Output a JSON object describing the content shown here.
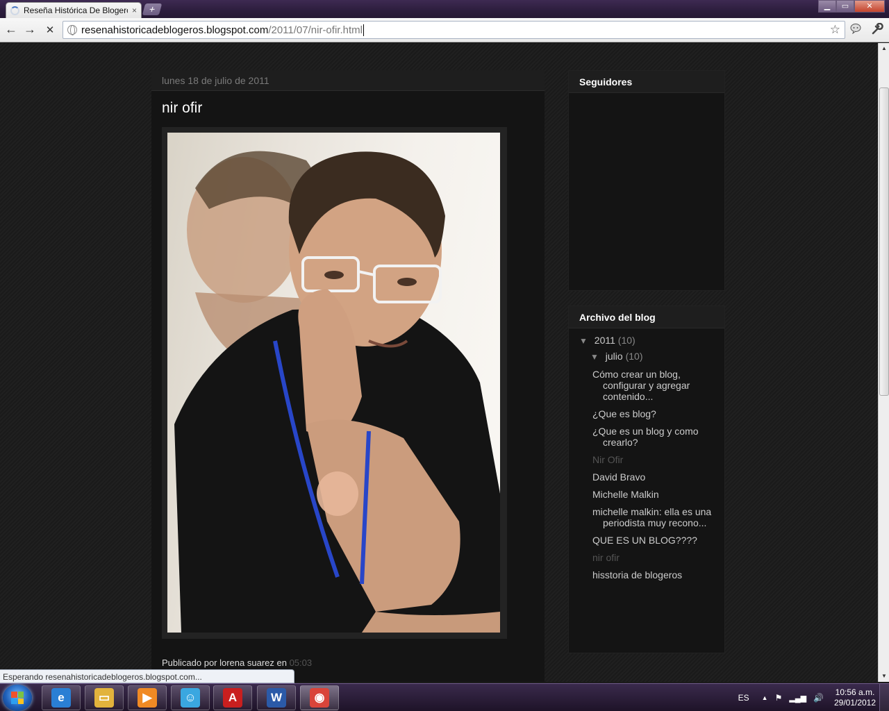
{
  "browser": {
    "tab_title": "Reseña Histórica De Blogeros",
    "tab_close": "×",
    "new_tab": "+",
    "window_buttons": {
      "minimize": "▁",
      "maximize": "▭",
      "close": "✕"
    },
    "nav": {
      "back": "←",
      "forward": "→",
      "stop": "✕"
    },
    "url_host": "resenahistoricadeblogeros.blogspot.com",
    "url_path": "/2011/07/nir-ofir.html",
    "bookmark_star": "☆",
    "icons": {
      "extension": "chat-bubble-icon",
      "wrench": "wrench-icon"
    },
    "status_text": "Esperando resenahistoricadeblogeros.blogspot.com..."
  },
  "post": {
    "date": "lunes 18 de julio de 2011",
    "title": "nir ofir",
    "byline_prefix": "Publicado por lorena suarez en",
    "byline_time": "05:03"
  },
  "sidebar": {
    "followers": {
      "title": "Seguidores"
    },
    "archive": {
      "title": "Archivo del blog",
      "year": {
        "toggle": "▼",
        "label": "2011",
        "count": "(10)"
      },
      "month": {
        "toggle": "▼",
        "label": "julio",
        "count": "(10)"
      },
      "posts": [
        {
          "label": "Cómo crear un blog, configurar y agregar contenido...",
          "current": false
        },
        {
          "label": "¿Que es blog?",
          "current": false
        },
        {
          "label": "¿Que es un blog y como crearlo?",
          "current": false
        },
        {
          "label": "Nir Ofir",
          "current": true
        },
        {
          "label": "David Bravo",
          "current": false
        },
        {
          "label": "Michelle Malkin",
          "current": false
        },
        {
          "label": "michelle malkin: ella es una periodista muy recono...",
          "current": false
        },
        {
          "label": "QUE ES UN BLOG????",
          "current": false
        },
        {
          "label": "nir ofir",
          "current": true
        },
        {
          "label": "hisstoria de blogeros",
          "current": false
        }
      ]
    }
  },
  "taskbar": {
    "apps": [
      {
        "name": "ie-icon",
        "glyph": "e",
        "color": "#2a7fd4"
      },
      {
        "name": "explorer-icon",
        "glyph": "▭",
        "color": "#e2b33c"
      },
      {
        "name": "media-player-icon",
        "glyph": "▶",
        "color": "#f08a24"
      },
      {
        "name": "messenger-icon",
        "glyph": "☺",
        "color": "#3aa7e0"
      },
      {
        "name": "acrobat-icon",
        "glyph": "A",
        "color": "#c91f1f"
      },
      {
        "name": "word-icon",
        "glyph": "W",
        "color": "#2b5aa8"
      },
      {
        "name": "chrome-icon",
        "glyph": "◉",
        "color": "#d9443a"
      }
    ],
    "language": "ES",
    "time": "10:56 a.m.",
    "date": "29/01/2012"
  }
}
